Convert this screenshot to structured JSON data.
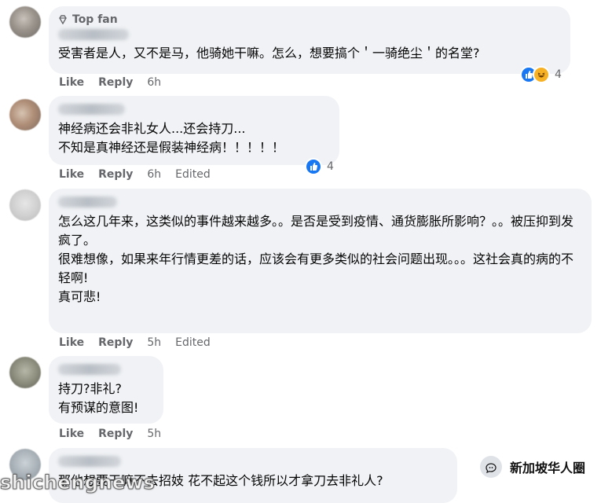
{
  "comments": [
    {
      "badge": "Top fan",
      "text": "受害者是人，又不是马，他骑她干嘛。怎么，想要搞个＇一骑绝尘＇的名堂?",
      "actions": {
        "like": "Like",
        "reply": "Reply",
        "time": "6h",
        "edited": ""
      },
      "reactions": {
        "types": [
          "like-icon",
          "haha-icon"
        ],
        "count": "4"
      }
    },
    {
      "badge": "",
      "text": "神经病还会非礼女人...还会持刀...\n不知是真神经还是假装神经病！！！！！",
      "actions": {
        "like": "Like",
        "reply": "Reply",
        "time": "6h",
        "edited": "Edited"
      },
      "reactions": {
        "types": [
          "like-icon"
        ],
        "count": "4"
      }
    },
    {
      "badge": "",
      "text": "怎么这几年来，这类似的事件越来越多。。是否是受到疫情、通货膨胀所影响？。。被压抑到发疯了。\n很难想像，如果来年行情更差的话，应该会有更多类似的社会问题出现。。。这社会真的病的不轻啊!\n真可悲!",
      "actions": {
        "like": "Like",
        "reply": "Reply",
        "time": "5h",
        "edited": "Edited"
      },
      "reactions": {
        "types": [],
        "count": ""
      }
    },
    {
      "badge": "",
      "text": "持刀?非礼?\n有预谋的意图!",
      "actions": {
        "like": "Like",
        "reply": "Reply",
        "time": "5h",
        "edited": ""
      },
      "reactions": {
        "types": [],
        "count": ""
      }
    },
    {
      "badge": "",
      "text": "那他想要干嘛不去招妓 花不起这个钱所以才拿刀去非礼人?",
      "actions": {
        "like": "",
        "reply": "",
        "time": "",
        "edited": ""
      },
      "reactions": {
        "types": [],
        "count": ""
      }
    }
  ],
  "watermarks": {
    "left": "shichengnews",
    "right": "新加坡华人圈"
  },
  "colors": {
    "bubble_bg": "#f0f2f5",
    "meta_gray": "#65676b",
    "like_blue": "#1877f2",
    "haha_yellow": "#f7b125"
  }
}
